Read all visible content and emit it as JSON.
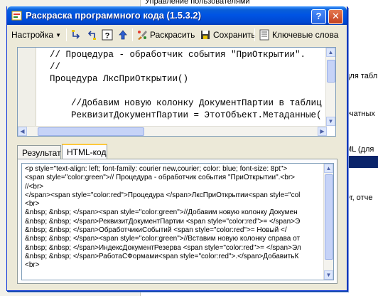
{
  "background": {
    "list_items": [
      "Управление пользователями"
    ],
    "right_fragments": [
      "для табл",
      "ечатных",
      "ML (для",
      "ет, отче"
    ]
  },
  "window": {
    "title": "Раскраска программного кода (1.5.3.2)",
    "help_label": "?",
    "close_label": "✕"
  },
  "toolbar": {
    "settings_label": "Настройка",
    "colorize_label": "Раскрасить",
    "save_label": "Сохранить",
    "keywords_label": "Ключевые слова"
  },
  "editor": {
    "lines": [
      "  // Процедура - обработчик события \"ПриОткрытии\".",
      "  //",
      "  Процедура ЛксПриОткрытии()",
      "",
      "      //Добавим новую колонку ДокументПартии в таблиц",
      "      РеквизитДокументПартии = ЭтотОбъект.Метаданные("
    ]
  },
  "tabs": [
    {
      "label": "Результат",
      "active": false
    },
    {
      "label": "HTML-код",
      "active": true
    }
  ],
  "html_code": {
    "lines": [
      "<p style=\"text-align: left; font-family: courier new,courier; color: blue; font-size: 8pt\">",
      "<span style=\"color:green\">// Процедура - обработчик события \"ПриОткрытии\".<br>",
      "//<br>",
      "</span><span style=\"color:red\">Процедура </span>ЛксПриОткрытии<span style=\"col",
      "<br>",
      "&nbsp; &nbsp; </span><span style=\"color:green\">//Добавим новую колонку Докумен",
      "&nbsp; &nbsp; </span>РеквизитДокументПартии <span style=\"color:red\">= </span>Э",
      "&nbsp; &nbsp; </span>ОбработчикиСобытий <span style=\"color:red\">= Новый </",
      "&nbsp; &nbsp; </span><span style=\"color:green\">//Вставим новую колонку справа от",
      "&nbsp; &nbsp; </span>ИндексДокументРезерва <span style=\"color:red\">= </span>Эл",
      "&nbsp; &nbsp; </span>РаботаСФормами<span style=\"color:red\">.</span>ДобавитьК",
      "<br>"
    ]
  },
  "colors": {
    "titlebar": "#0054e3",
    "dialog_bg": "#ece9d8",
    "selection": "#0a246a"
  }
}
